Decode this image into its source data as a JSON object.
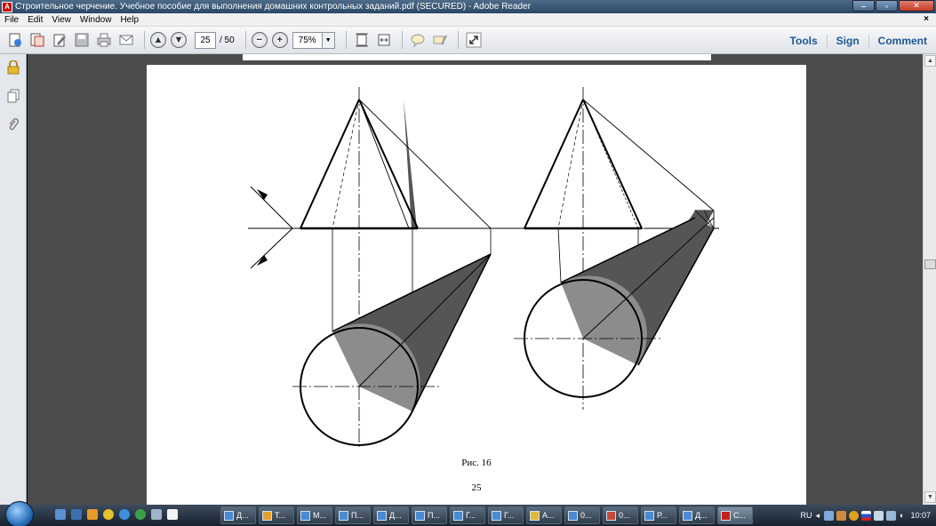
{
  "window": {
    "title": "Строительное черчение. Учебное пособие для выполнения домашних контрольных заданий.pdf (SECURED) - Adobe Reader",
    "minimize_icon": "minimize-icon",
    "maximize_icon": "maximize-icon",
    "close_icon": "close-icon"
  },
  "menu": {
    "items": [
      "File",
      "Edit",
      "View",
      "Window",
      "Help"
    ],
    "close_label": "×"
  },
  "toolbar": {
    "page_current": "25",
    "page_total": "/ 50",
    "zoom": "75%",
    "links": [
      "Tools",
      "Sign",
      "Comment"
    ]
  },
  "document": {
    "figure_caption": "Рис. 16",
    "page_number": "25"
  },
  "taskbar": {
    "tasks": [
      "Д...",
      "Т...",
      "М...",
      "П...",
      "Д...",
      "П...",
      "Г...",
      "Г...",
      "А...",
      "0...",
      "0...",
      "Р...",
      "Д...",
      "С..."
    ],
    "language": "RU",
    "clock": "10:07"
  },
  "colors": {
    "accent_link": "#1f5792",
    "shade_dark": "#555555",
    "shade_light": "#8c8c8c"
  }
}
